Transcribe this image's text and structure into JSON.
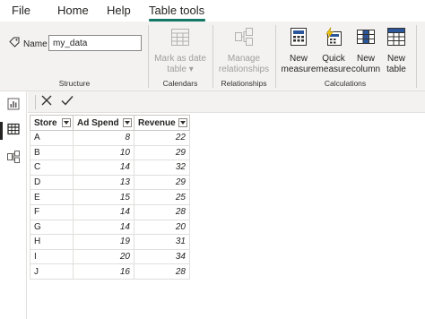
{
  "menu": {
    "tabs": [
      {
        "label": "File"
      },
      {
        "label": "Home"
      },
      {
        "label": "Help"
      },
      {
        "label": "Table tools",
        "active": true
      }
    ]
  },
  "ribbon": {
    "structure": {
      "name_label": "Name",
      "name_value": "my_data",
      "group_label": "Structure"
    },
    "calendars": {
      "mark_as_date_table": "Mark as date\ntable ▾",
      "mark_line1": "Mark as date",
      "mark_line2": "table ▾",
      "group_label": "Calendars",
      "disabled": true
    },
    "relationships": {
      "manage_line1": "Manage",
      "manage_line2": "relationships",
      "group_label": "Relationships",
      "disabled": true
    },
    "calculations": {
      "new_measure_line1": "New",
      "new_measure_line2": "measure",
      "quick_measure_line1": "Quick",
      "quick_measure_line2": "measure",
      "new_column_line1": "New",
      "new_column_line2": "column",
      "new_table_line1": "New",
      "new_table_line2": "table",
      "group_label": "Calculations"
    }
  },
  "left_rail": {
    "items": [
      {
        "icon": "report-view-icon"
      },
      {
        "icon": "data-view-icon",
        "active": true
      },
      {
        "icon": "model-view-icon"
      }
    ]
  },
  "formula_bar": {
    "cancel_icon": "close-icon",
    "commit_icon": "check-icon"
  },
  "table": {
    "columns": [
      "Store",
      "Ad Spend",
      "Revenue"
    ],
    "rows": [
      [
        "A",
        "8",
        "22"
      ],
      [
        "B",
        "10",
        "29"
      ],
      [
        "C",
        "14",
        "32"
      ],
      [
        "D",
        "13",
        "29"
      ],
      [
        "E",
        "15",
        "25"
      ],
      [
        "F",
        "14",
        "28"
      ],
      [
        "G",
        "14",
        "20"
      ],
      [
        "H",
        "19",
        "31"
      ],
      [
        "I",
        "20",
        "34"
      ],
      [
        "J",
        "16",
        "28"
      ]
    ]
  },
  "colors": {
    "accent": "#117865",
    "ribbon_bg": "#f3f2f1",
    "disabled_text": "#a19f9d",
    "icon_blue": "#2b579a",
    "icon_yellow": "#f2c811"
  }
}
